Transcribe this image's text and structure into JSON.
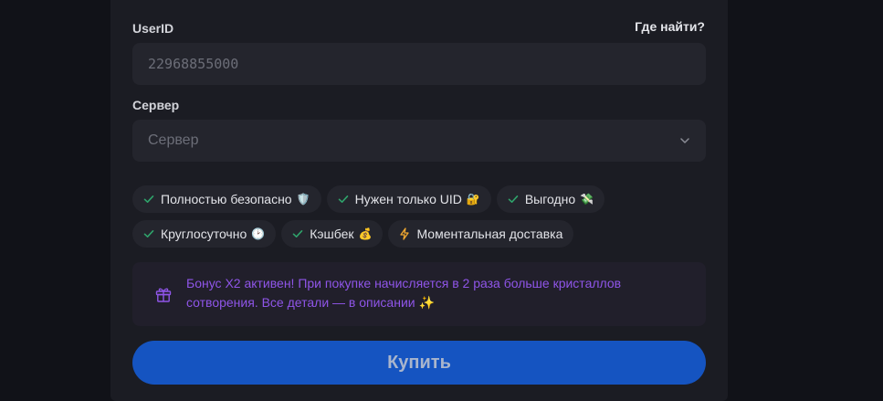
{
  "form": {
    "userid_label": "UserID",
    "help_link": "Где найти?",
    "userid_placeholder": "22968855000",
    "server_label": "Сервер",
    "server_value": "Сервер"
  },
  "features": [
    {
      "label": "Полностью безопасно",
      "emoji": "🛡️",
      "icon": "check-icon"
    },
    {
      "label": "Нужен только UID",
      "emoji": "🔐",
      "icon": "check-icon"
    },
    {
      "label": "Выгодно",
      "emoji": "💸",
      "icon": "check-icon"
    },
    {
      "label": "Круглосуточно",
      "emoji": "🕑",
      "icon": "check-icon"
    },
    {
      "label": "Кэшбек",
      "emoji": "💰",
      "icon": "check-icon"
    },
    {
      "label": "Моментальная доставка",
      "emoji": "",
      "icon": "lightning-icon"
    }
  ],
  "bonus": {
    "text": "Бонус X2 активен! При покупке начисляется в 2 раза больше кристаллов сотворения. Все детали — в описании ✨",
    "icon": "gift-icon"
  },
  "buy_label": "Купить",
  "colors": {
    "accent": "#1554c1",
    "check": "#2fa36b",
    "bonus_text": "#8f55e8",
    "lightning": "#f0a830"
  }
}
